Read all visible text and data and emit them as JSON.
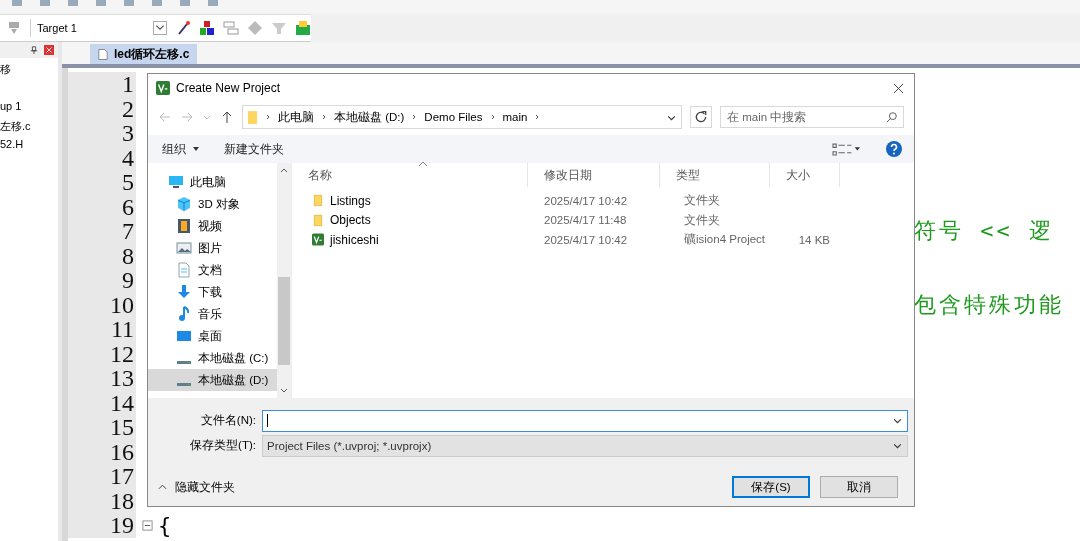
{
  "toolbar": {
    "target": "Target 1"
  },
  "project_panel": {
    "items": [
      "移",
      "up 1",
      "左移.c",
      "52.H"
    ]
  },
  "editor": {
    "tab": {
      "label": "led循环左移.c",
      "selected": true
    },
    "lines": [
      {
        "number": "1",
        "fold": false
      },
      {
        "number": "2",
        "fold": false
      },
      {
        "number": "3",
        "fold": false
      },
      {
        "number": "4",
        "fold": false
      },
      {
        "number": "5",
        "fold": false
      },
      {
        "number": "6",
        "fold": false
      },
      {
        "number": "7",
        "kind": "tail",
        "text": "符号 <<  逻",
        "fold": false
      },
      {
        "number": "8",
        "fold": false
      },
      {
        "number": "9",
        "fold": false
      },
      {
        "number": "10",
        "kind": "tail",
        "text": "包含特殊功能",
        "fold": false
      },
      {
        "number": "11",
        "fold": false
      },
      {
        "number": "12",
        "fold": false
      },
      {
        "number": "13",
        "fold": false
      },
      {
        "number": "14",
        "fold": false
      },
      {
        "number": "15",
        "fold": false
      },
      {
        "number": "16",
        "fold": false
      },
      {
        "number": "17",
        "fold": false
      },
      {
        "number": "18",
        "fold": false
      },
      {
        "number": "19",
        "kind": "full",
        "text": "{",
        "fold": true
      }
    ]
  },
  "dialog": {
    "title": "Create New Project",
    "breadcrumbs": [
      "此电脑",
      "本地磁盘 (D:)",
      "Demo Files",
      "main"
    ],
    "search": {
      "placeholder": "在 main 中搜索"
    },
    "commands": [
      {
        "label": "组织",
        "menu": true
      },
      {
        "label": "新建文件夹",
        "menu": false
      }
    ],
    "nav": [
      {
        "label": "此电脑",
        "kind": "pc",
        "selected": false,
        "child": false
      },
      {
        "label": "3D 对象",
        "kind": "cube",
        "selected": false,
        "child": true
      },
      {
        "label": "视频",
        "kind": "video",
        "selected": false,
        "child": true
      },
      {
        "label": "图片",
        "kind": "image",
        "selected": false,
        "child": true
      },
      {
        "label": "文档",
        "kind": "doc",
        "selected": false,
        "child": true
      },
      {
        "label": "下载",
        "kind": "download",
        "selected": false,
        "child": true
      },
      {
        "label": "音乐",
        "kind": "music",
        "selected": false,
        "child": true
      },
      {
        "label": "桌面",
        "kind": "desktop",
        "selected": false,
        "child": true
      },
      {
        "label": "本地磁盘 (C:)",
        "kind": "drive",
        "selected": false,
        "child": true
      },
      {
        "label": "本地磁盘 (D:)",
        "kind": "drive",
        "selected": true,
        "child": true
      }
    ],
    "columns": [
      "名称",
      "修改日期",
      "类型",
      "大小"
    ],
    "files": [
      {
        "name": "Listings",
        "kind": "folder",
        "modified": "2025/4/17 10:42",
        "type": "文件夹"
      },
      {
        "name": "Objects",
        "kind": "folder",
        "modified": "2025/4/17 11:48",
        "type": "文件夹"
      },
      {
        "name": "jishiceshi",
        "kind": "project",
        "modified": "2025/4/17 10:42",
        "type": "礦ision4 Project",
        "size": "14 KB"
      }
    ],
    "filename_label": "文件名(N):",
    "filetype_label": "保存类型(T):",
    "filetype": "Project Files (*.uvproj; *.uvprojx)",
    "hide_folders": "隐藏文件夹",
    "buttons": [
      {
        "label": "保存(S)",
        "selected": true
      },
      {
        "label": "取消",
        "selected": false
      }
    ]
  }
}
